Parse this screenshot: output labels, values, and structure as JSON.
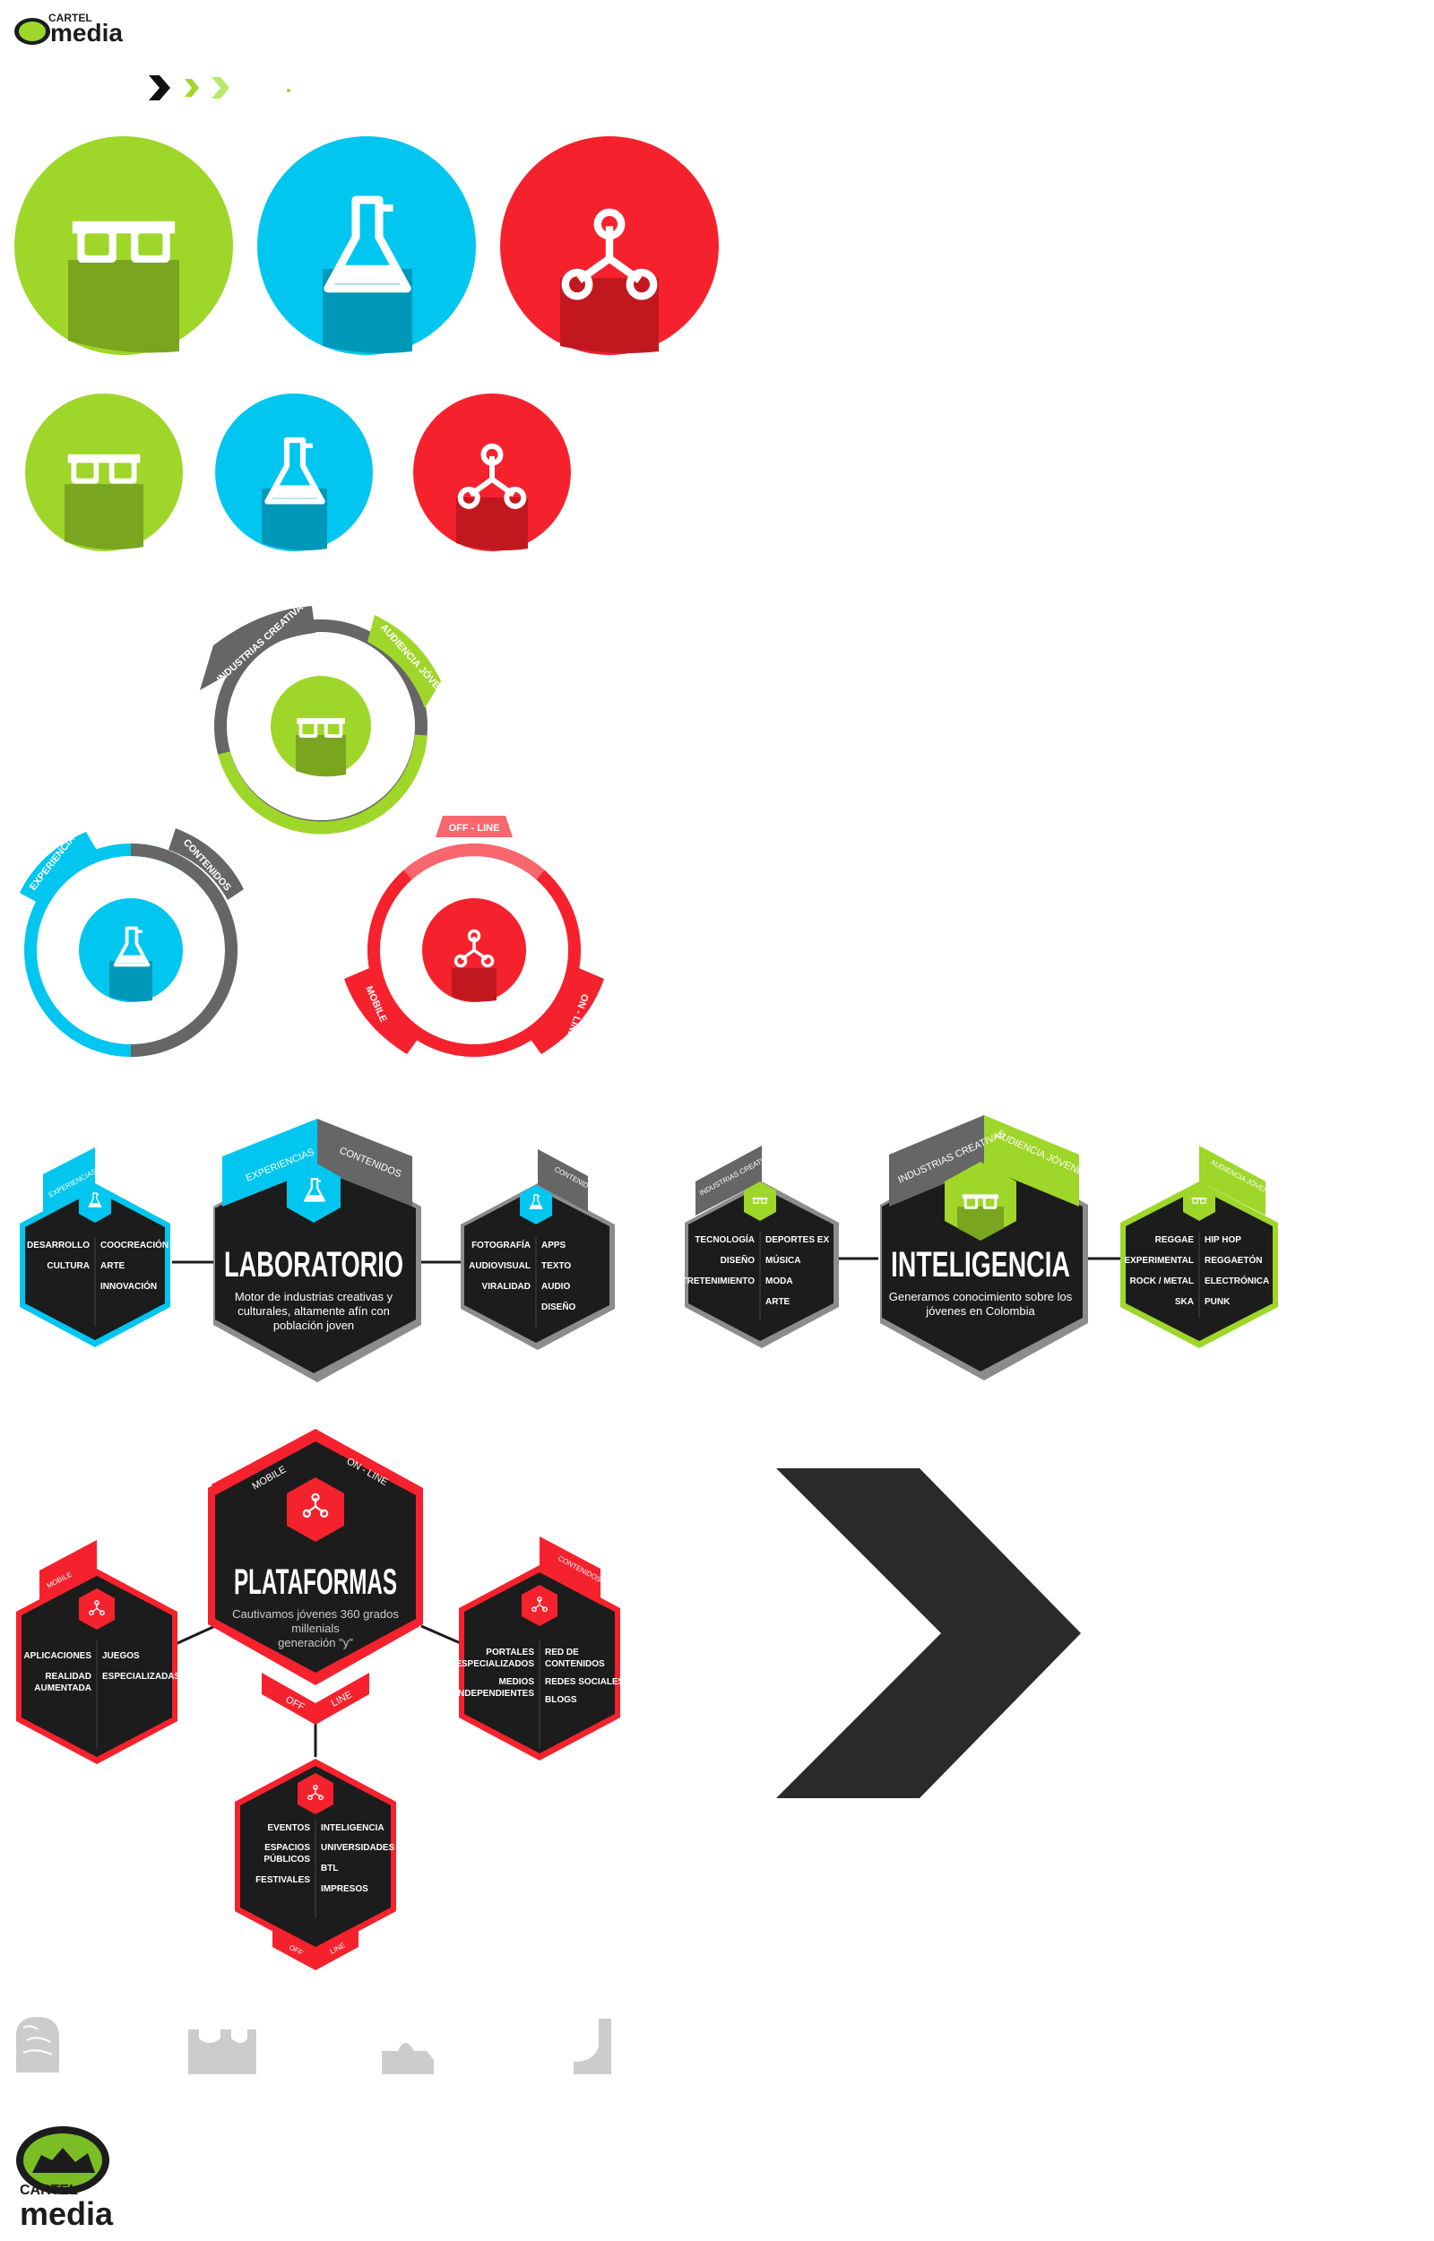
{
  "brand": {
    "small_top": "CARTEL",
    "small_bottom": "media",
    "big_top": "CARTEL",
    "big_bottom": "media"
  },
  "colors": {
    "green": "#9fd62a",
    "blue": "#00c6f0",
    "red": "#f5222d",
    "dark": "#1c1c1c",
    "gray": "#666666",
    "white": "#ffffff"
  },
  "icons": {
    "green": "glasses-icon",
    "blue": "flask-icon",
    "red": "network-icon"
  },
  "rings": {
    "green": {
      "tab_left": "INDUSTRIAS CREATIVAS",
      "tab_right": "AUDIENCIA JÓVENES"
    },
    "blue": {
      "tab_left": "EXPERIENCIAS",
      "tab_right": "CONTENIDOS"
    },
    "red": {
      "tab_top": "OFF - LINE",
      "tab_left": "MOBILE",
      "tab_right": "ON - LINE"
    }
  },
  "laboratorio": {
    "title": "LABORATORIO",
    "desc_1": "Motor de industrias creativas y",
    "desc_2": "culturales, altamente afín con",
    "desc_3": "población joven",
    "tab_left": "EXPERIENCIAS",
    "tab_right": "CONTENIDOS",
    "left_tab": "EXPERIENCIAS",
    "left_col1": [
      "DESARROLLO",
      "CULTURA"
    ],
    "left_col2": [
      "COOCREACIÓN",
      "ARTE",
      "INNOVACIÓN"
    ],
    "right_tab": "CONTENIDOS",
    "right_col1": [
      "FOTOGRAFÍA",
      "AUDIOVISUAL",
      "VIRALIDAD"
    ],
    "right_col2": [
      "APPS",
      "TEXTO",
      "AUDIO",
      "DISEÑO"
    ]
  },
  "inteligencia": {
    "title": "INTELIGENCIA",
    "desc_1": "Generamos conocimiento sobre los",
    "desc_2": "jóvenes en Colombia",
    "tab_left": "INDUSTRIAS CREATIVAS",
    "tab_right": "AUDIENCIA JÓVENES",
    "left_tab": "INDUSTRIAS CREATIVAS",
    "left_col1": [
      "TECNOLOGÍA",
      "DISEÑO",
      "ENTRETENIMIENTO"
    ],
    "left_col2": [
      "DEPORTES EX",
      "MÚSICA",
      "MODA",
      "ARTE"
    ],
    "right_tab": "AUDIENCIA JÓVENES",
    "right_col1": [
      "REGGAE",
      "EXPERIMENTAL",
      "ROCK / METAL",
      "SKA"
    ],
    "right_col2": [
      "HIP HOP",
      "REGGAETÓN",
      "ELECTRÓNICA",
      "PUNK"
    ]
  },
  "plataformas": {
    "title": "PLATAFORMAS",
    "desc_1": "Cautivamos jóvenes 360 grados",
    "desc_2": "millenials",
    "desc_3": "generación \"y\"",
    "tab_left": "MOBILE",
    "tab_right": "ON - LINE",
    "tab_bottom_left": "OFF",
    "tab_bottom_right": "LINE",
    "left_tab": "MOBILE",
    "left_col1": [
      "APLICACIONES",
      "REALIDAD",
      "AUMENTADA"
    ],
    "left_col2": [
      "JUEGOS",
      "ESPECIALIZADAS"
    ],
    "right_tab": "CONTENIDOS",
    "right_col1": [
      "PORTALES",
      "ESPECIALIZADOS",
      "MEDIOS",
      "INDEPENDIENTES"
    ],
    "right_col2": [
      "RED DE",
      "CONTENIDOS",
      "REDES SOCIALES",
      "BLOGS"
    ],
    "bottom_col1": [
      "EVENTOS",
      "ESPACIOS",
      "PÚBLICOS",
      "FESTIVALES"
    ],
    "bottom_col2": [
      "INTELIGENCIA",
      "UNIVERSIDADES",
      "BTL",
      "IMPRESOS"
    ],
    "bottom_tab_left": "OFF",
    "bottom_tab_right": "LINE"
  }
}
